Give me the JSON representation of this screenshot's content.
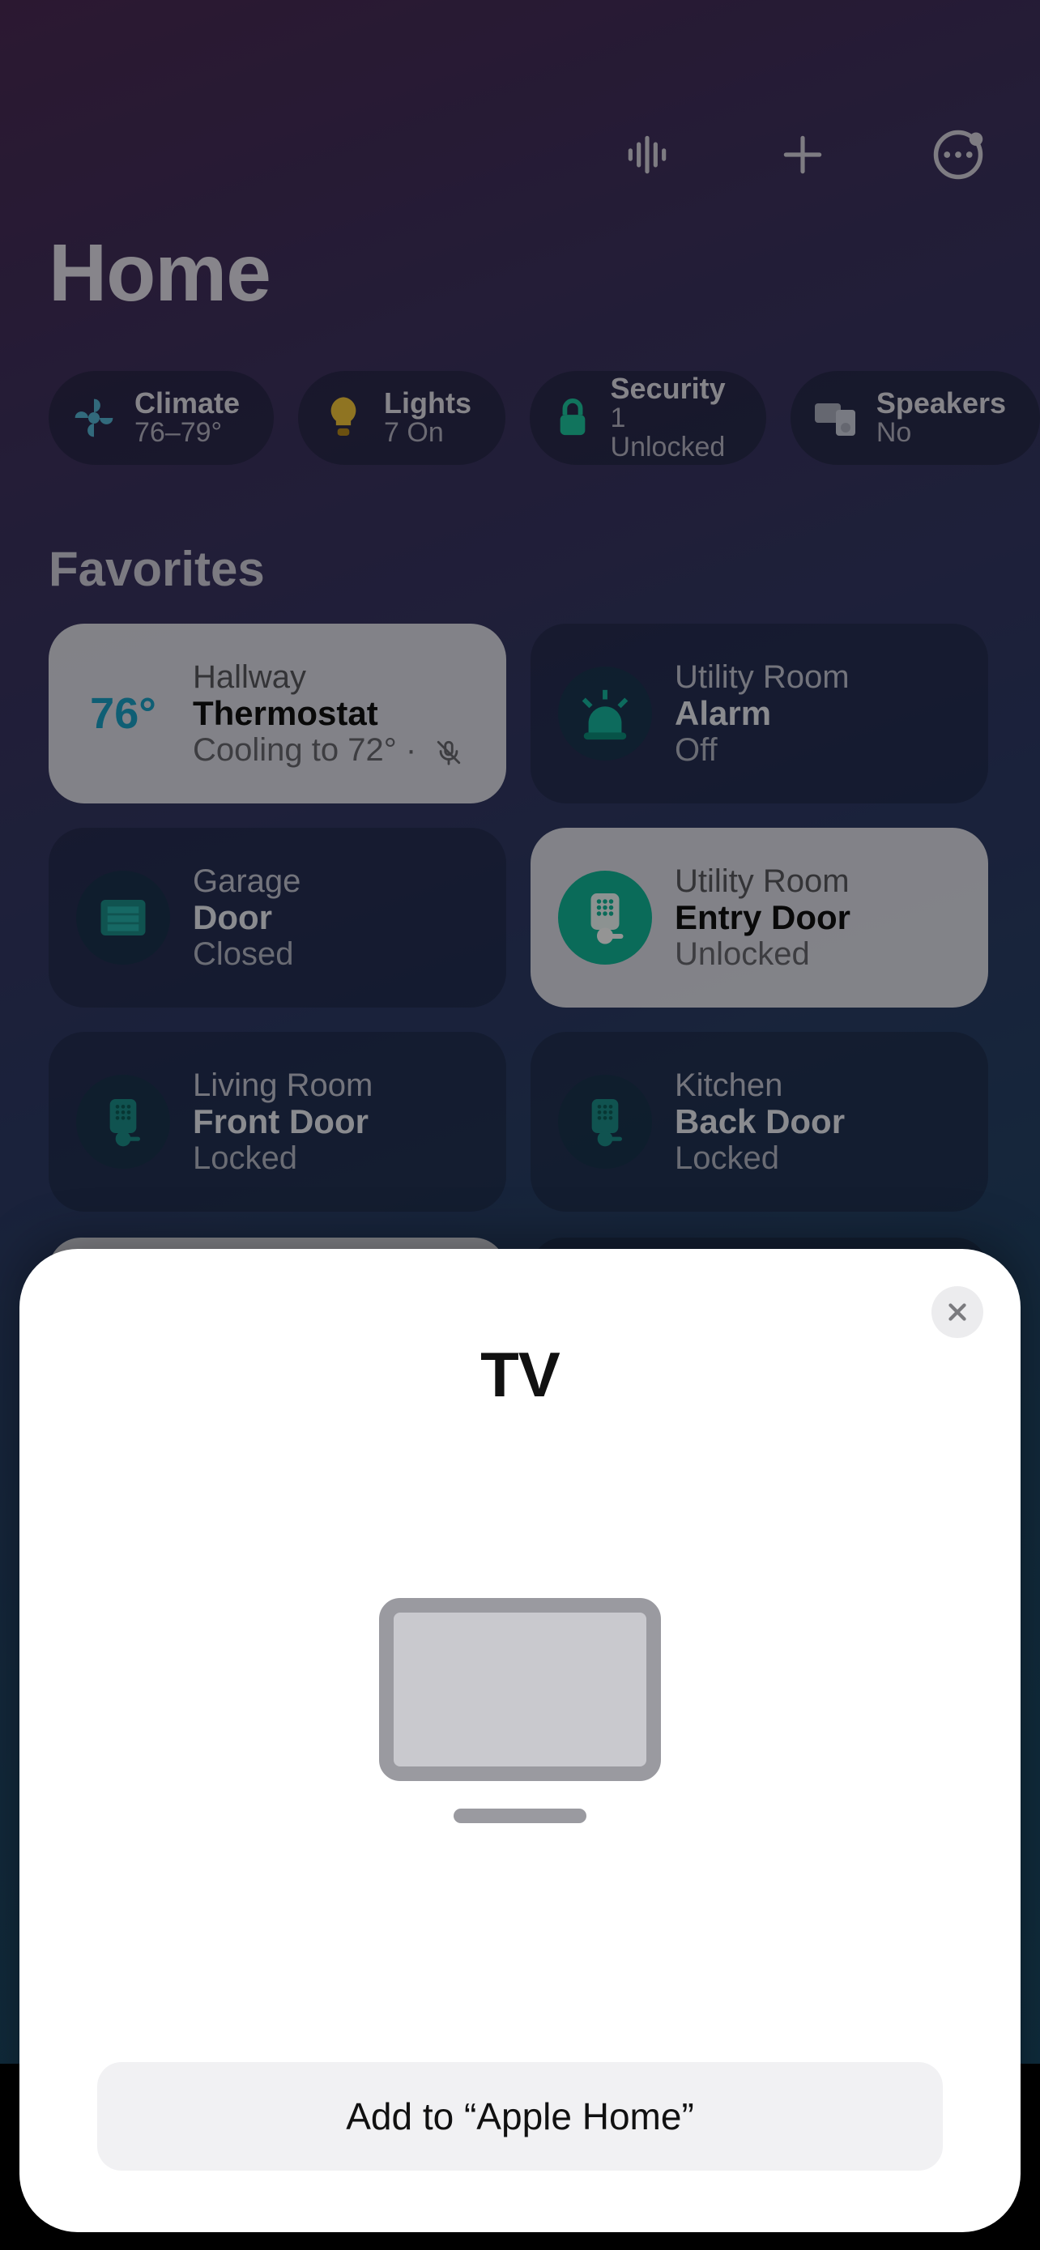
{
  "header": {
    "title": "Home"
  },
  "categories": [
    {
      "icon": "fan",
      "title": "Climate",
      "sub": "76–79°"
    },
    {
      "icon": "bulb",
      "title": "Lights",
      "sub": "7 On"
    },
    {
      "icon": "lock",
      "title": "Security",
      "sub": "1 Unlocked"
    },
    {
      "icon": "speaker",
      "title": "Speakers",
      "sub": "No"
    }
  ],
  "favorites_label": "Favorites",
  "tiles": [
    {
      "style": "light",
      "icon": "temp",
      "temp": "76°",
      "room": "Hallway",
      "name": "Thermostat",
      "status": "Cooling to 72° · ",
      "mic_off": true
    },
    {
      "style": "dark",
      "icon": "alarm",
      "room": "Utility Room",
      "name": "Alarm",
      "status": "Off"
    },
    {
      "style": "dark",
      "icon": "garage",
      "room": "Garage",
      "name": "Door",
      "status": "Closed"
    },
    {
      "style": "light",
      "icon": "keypad-open",
      "room": "Utility Room",
      "name": "Entry Door",
      "status": "Unlocked"
    },
    {
      "style": "dark",
      "icon": "keypad",
      "room": "Living Room",
      "name": "Front Door",
      "status": "Locked"
    },
    {
      "style": "dark",
      "icon": "keypad",
      "room": "Kitchen",
      "name": "Back Door",
      "status": "Locked"
    }
  ],
  "sheet": {
    "title": "TV",
    "action": "Add to “Apple Home”"
  }
}
